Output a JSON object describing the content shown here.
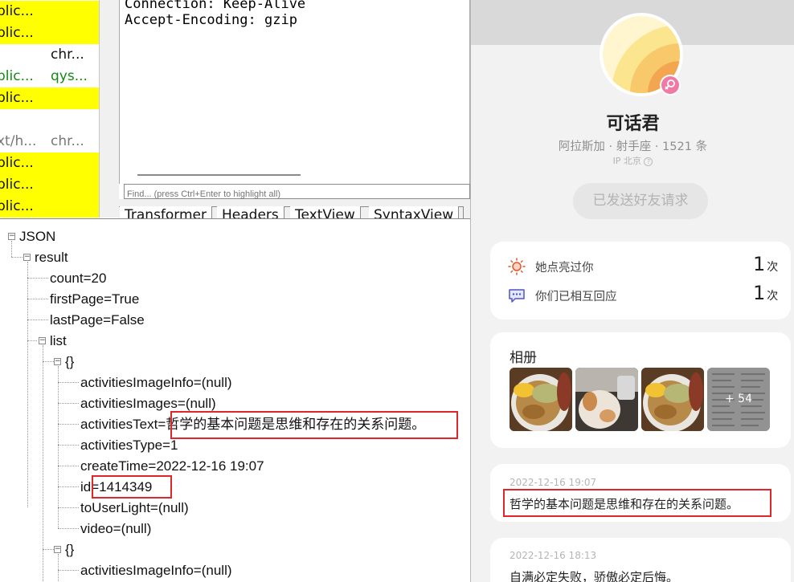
{
  "sessions": [
    {
      "ct": "plic...",
      "host": "",
      "style": "yellow"
    },
    {
      "ct": "plic...",
      "host": "",
      "style": "yellow"
    },
    {
      "ct": "",
      "host": "chr...",
      "style": "plain"
    },
    {
      "ct": "plic...",
      "host": "qys...",
      "style": "green"
    },
    {
      "ct": "plic...",
      "host": "",
      "style": "yellow"
    },
    {
      "ct": "",
      "host": "",
      "style": "plain"
    },
    {
      "ct": "xt/h...",
      "host": "chr...",
      "style": "gray"
    },
    {
      "ct": "plic...",
      "host": "",
      "style": "yellow"
    },
    {
      "ct": "plic...",
      "host": "",
      "style": "yellow"
    },
    {
      "ct": "plic...",
      "host": "",
      "style": "yellow"
    }
  ],
  "request_view": {
    "lines": [
      "Connection: Keep-Alive",
      "Accept-Encoding: gzip"
    ],
    "find_placeholder": "Find... (press Ctrl+Enter to highlight all)"
  },
  "response_tabs": [
    "Transformer",
    "Headers",
    "TextView",
    "SyntaxView"
  ],
  "tree": {
    "root": "JSON",
    "result": "result",
    "count": "count=20",
    "firstPage": "firstPage=True",
    "lastPage": "lastPage=False",
    "list": "list",
    "obj": "{}",
    "item1": {
      "f1": "activitiesImageInfo=(null)",
      "f2": "activitiesImages=(null)",
      "f3_key": "activitiesText=",
      "f3_val": "哲学的基本问题是思维和存在的关系问题。",
      "f4": "activitiesType=1",
      "f5": "createTime=2022-12-16 19:07",
      "f6_key": "id=",
      "f6_val": "1414349",
      "f7": "toUserLight=(null)",
      "f8": "video=(null)"
    },
    "item2_f1": "activitiesImageInfo=(null)"
  },
  "profile": {
    "name": "可话君",
    "meta": "阿拉斯加 · 射手座 · 1521 条",
    "ip": "IP 北京",
    "friend_request_button": "已发送好友请求",
    "stats": [
      {
        "label": "她点亮过你",
        "count": "1",
        "unit": "次",
        "icon": "sun-icon"
      },
      {
        "label": "你们已相互回应",
        "count": "1",
        "unit": "次",
        "icon": "chat-icon"
      }
    ],
    "album_title": "相册",
    "album_more": "+ 54",
    "posts": [
      {
        "date": "2022-12-16 19:07",
        "text": "哲学的基本问题是思维和存在的关系问题。"
      },
      {
        "date": "2022-12-16 18:13",
        "text": "自满必定失败，骄傲必定后悔。"
      }
    ]
  },
  "colors": {
    "highlight_box": "#e0262a",
    "session_yellow": "#ffff00",
    "button_disabled": "#e6e6e6"
  }
}
